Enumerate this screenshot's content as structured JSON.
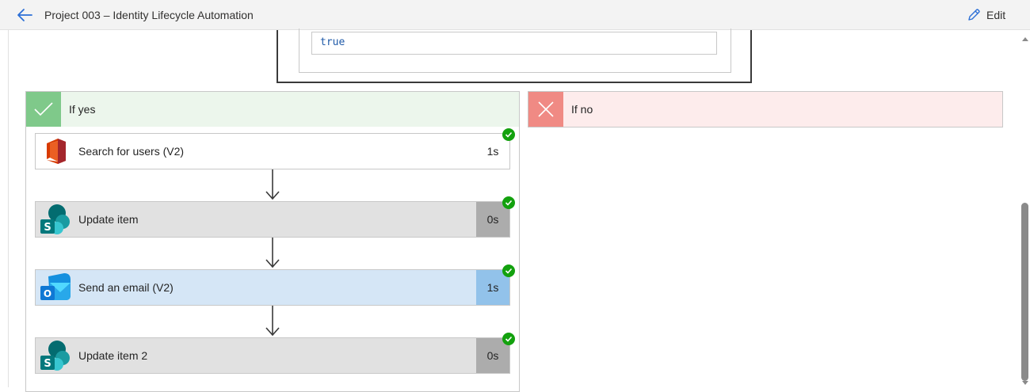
{
  "header": {
    "title": "Project 003 – Identity Lifecycle Automation",
    "back_icon": "arrow-left-icon",
    "edit_label": "Edit",
    "edit_icon": "pencil-icon"
  },
  "condition": {
    "value": "true"
  },
  "branches": {
    "yes": {
      "label": "If yes",
      "icon": "checkmark-icon",
      "color": "#7fc98a",
      "bg": "#ecf6ec"
    },
    "no": {
      "label": "If no",
      "icon": "close-icon",
      "color": "#f08a84",
      "bg": "#fdecec"
    }
  },
  "actions": [
    {
      "name": "Search for users (V2)",
      "duration": "1s",
      "connector": "office-365-users-icon",
      "status": "succeeded"
    },
    {
      "name": "Update item",
      "duration": "0s",
      "connector": "sharepoint-icon",
      "status": "succeeded"
    },
    {
      "name": "Send an email (V2)",
      "duration": "1s",
      "connector": "outlook-icon",
      "status": "succeeded"
    },
    {
      "name": "Update item 2",
      "duration": "0s",
      "connector": "sharepoint-icon",
      "status": "succeeded"
    }
  ],
  "colors": {
    "success": "#13a10e",
    "accent_blue": "#2b6fd6",
    "card_grey": "#e1e1e1",
    "card_blue": "#d5e6f6"
  }
}
